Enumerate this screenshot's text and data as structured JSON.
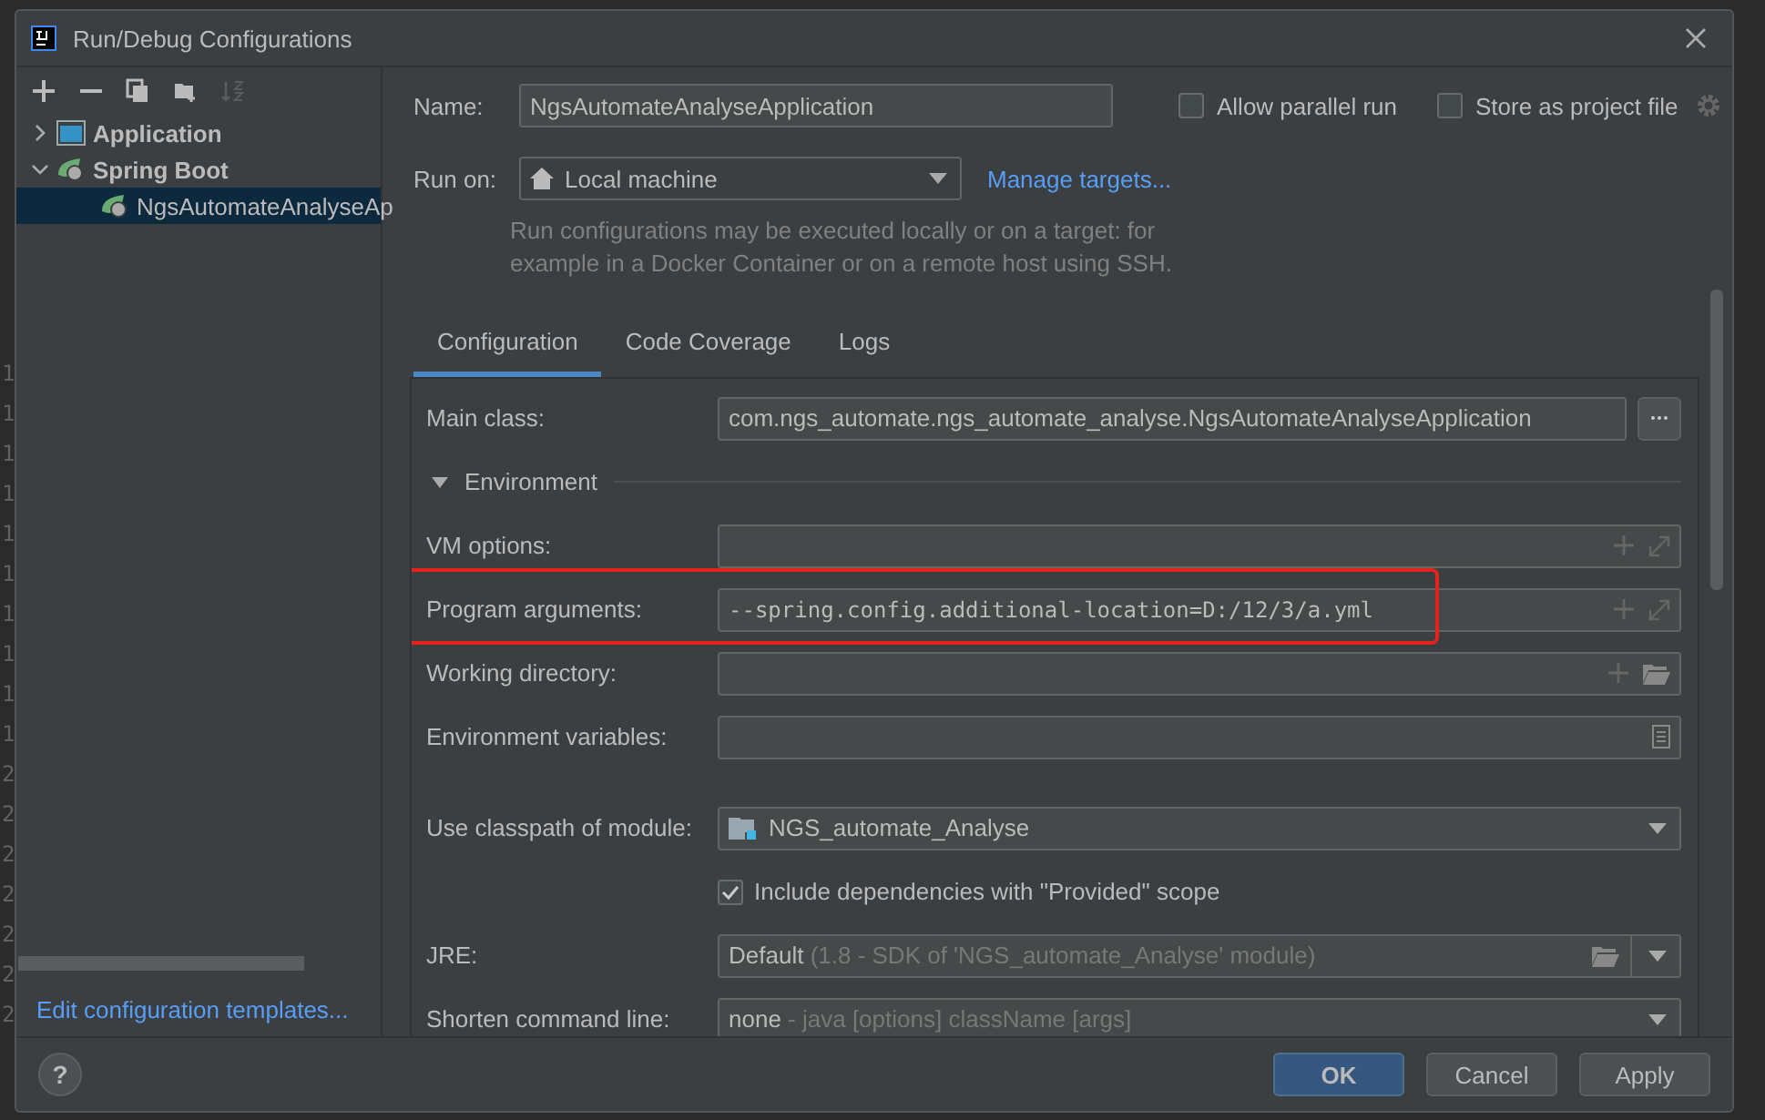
{
  "background_editor": {
    "line_numbers": [
      "1",
      "1",
      "1",
      "1",
      "1",
      "1",
      "1",
      "1",
      "1",
      "1",
      "2",
      "2",
      "2",
      "2",
      "2",
      "2",
      "2"
    ]
  },
  "window": {
    "title": "Run/Debug Configurations"
  },
  "toolbar": [
    {
      "kind": "add",
      "disabled": false
    },
    {
      "kind": "remove",
      "disabled": false
    },
    {
      "kind": "copy",
      "disabled": false
    },
    {
      "kind": "folder",
      "disabled": false
    },
    {
      "kind": "sort",
      "disabled": true
    }
  ],
  "tree": [
    {
      "label": "Application",
      "kind": "application",
      "expanded": false,
      "selected": false
    },
    {
      "label": "Spring Boot",
      "kind": "spring",
      "expanded": true,
      "selected": false,
      "children": [
        {
          "label": "NgsAutomateAnalyseAp",
          "kind": "spring-app",
          "selected": true
        }
      ]
    }
  ],
  "edit_templates_link": "Edit configuration templates...",
  "name": {
    "label": "Name:",
    "value": "NgsAutomateAnalyseApplication"
  },
  "options": [
    {
      "label": "Allow parallel run",
      "checked": false
    },
    {
      "label": "Store as project file",
      "checked": false
    }
  ],
  "run_on": {
    "label": "Run on:",
    "value": "Local machine",
    "link": "Manage targets...",
    "hint": "Run configurations may be executed locally or on a target: for example in a Docker Container or on a remote host using SSH."
  },
  "tabs": [
    {
      "label": "Configuration",
      "selected": true
    },
    {
      "label": "Code Coverage",
      "selected": false
    },
    {
      "label": "Logs",
      "selected": false
    }
  ],
  "fields": [
    {
      "kind": "text",
      "label": "Main class:",
      "value": "com.ngs_automate.ngs_automate_analyse.NgsAutomateAnalyseApplication"
    },
    {
      "kind": "section",
      "label": "Environment",
      "expanded": true
    },
    {
      "kind": "expandable",
      "label": "VM options:"
    },
    {
      "kind": "expandable",
      "label": "Program arguments:",
      "value": "--spring.config.additional-location=D:/12/3/a.yml",
      "highlighted": true
    },
    {
      "kind": "path",
      "label": "Working directory:"
    },
    {
      "kind": "env",
      "label": "Environment variables:"
    },
    {
      "kind": "module",
      "label": "Use classpath of module:",
      "value": "NGS_automate_Analyse"
    },
    {
      "kind": "checkbox",
      "label": "Include dependencies with \"Provided\" scope",
      "checked": true
    },
    {
      "kind": "jre",
      "label": "JRE:",
      "value": "Default",
      "detail": "(1.8 - SDK of 'NGS_automate_Analyse' module)"
    },
    {
      "kind": "combo",
      "label": "Shorten command line:",
      "value": "none",
      "detail": "- java [options] className [args]"
    }
  ],
  "help": "?",
  "buttons": [
    {
      "label": "OK",
      "default": true
    },
    {
      "label": "Cancel",
      "default": false
    },
    {
      "label": "Apply",
      "default": false
    }
  ]
}
